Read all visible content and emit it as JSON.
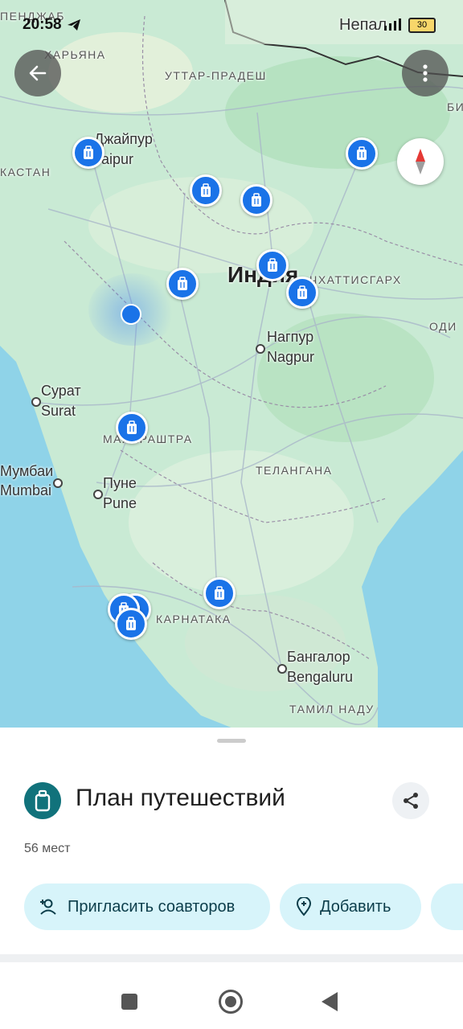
{
  "status_bar": {
    "time": "20:58",
    "battery": "30"
  },
  "map": {
    "labels": {
      "pendzhab": "ПЕНДЖАБ",
      "haryana": "ХАРЬЯНА",
      "uttar": "УТТАР-ПРАДЕШ",
      "nepal": "Непал",
      "jaipur_ru": "Джайпур",
      "jaipur_en": "Jaipur",
      "rajasthan": "КАСТАН",
      "india": "Индия",
      "chhattisgarh": "ЧХАТТИСГАРХ",
      "odisha": "ОДИ",
      "bi": "БИ",
      "nagpur_ru": "Нагпур",
      "nagpur_en": "Nagpur",
      "surat_ru": "Сурат",
      "surat_en": "Surat",
      "maharashtra": "МАХАРАШТРА",
      "mumbai_ru": "Мумбаи",
      "mumbai_en": "Mumbai",
      "pune_ru": "Пуне",
      "pune_en": "Pune",
      "telangana": "ТЕЛАНГАНА",
      "karnataka": "КАРНАТАКА",
      "bangalore_ru": "Бангалор",
      "bangalore_en": "Bengaluru",
      "tamilnadu": "ТАМИЛ НАДУ"
    },
    "pin_icon": "luggage-icon"
  },
  "sheet": {
    "title": "План путешествий",
    "count": "56 мест",
    "invite_label": "Пригласить соавторов",
    "add_label": "Добавить"
  },
  "colors": {
    "accent": "#1a73e8",
    "list_icon": "#11727b",
    "chip": "#d7f4fa",
    "land": "#cfead6",
    "water": "#8ad0e6"
  }
}
